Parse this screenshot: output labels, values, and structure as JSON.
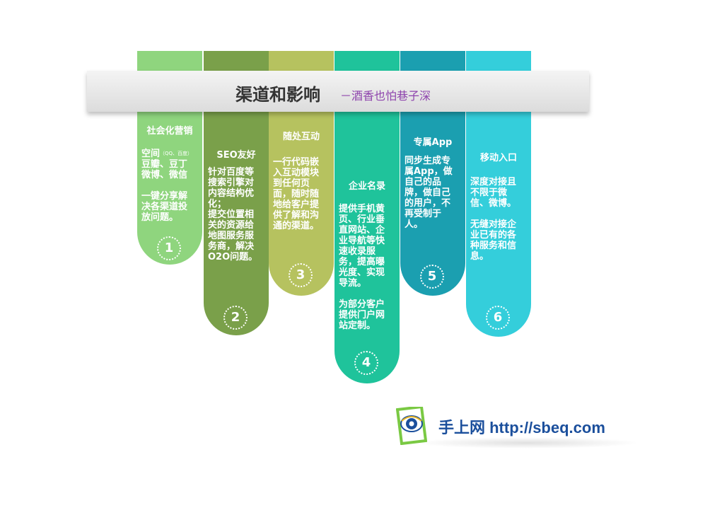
{
  "banner": {
    "title": "渠道和影响",
    "subtitle": "－酒香也怕巷子深"
  },
  "columns": [
    {
      "title": "社会化营销",
      "body_pre": "空间",
      "body_small": "（QQ、百度）",
      "body": "豆瓣、豆丁\n微博、微信\n\n一键分享解\n决各渠道投\n放问题。",
      "number": "1",
      "color": "#8fd57e"
    },
    {
      "title": "SEO友好",
      "body": "针对百度等\n搜索引擎对\n内容结构优\n化；\n提交位置相\n关的资源给\n地图服务服\n务商，解决\nO2O问题。",
      "number": "2",
      "color": "#7aa04a"
    },
    {
      "title": "随处互动",
      "body": "一行代码嵌\n入互动模块\n到任何页\n面，随时随\n地给客户提\n供了解和沟\n通的渠道。",
      "number": "3",
      "color": "#b6c25f"
    },
    {
      "title": "企业名录",
      "body": "提供手机黄\n页、行业垂\n直网站、企\n业导航等快\n速收录服\n务，提高曝\n光度、实现\n导流。\n\n为部分客户\n提供门户网\n站定制。",
      "number": "4",
      "color": "#1fc39b"
    },
    {
      "title": "专属App",
      "body": "同步生成专\n属App，做\n自己的品\n牌，做自己\n的用户，不\n再受制于\n人。",
      "number": "5",
      "color": "#1b9fb0"
    },
    {
      "title": "移动入口",
      "body": "深度对接且\n不限于微\n信、微博。\n\n无缝对接企\n业已有的各\n种服务和信\n息。",
      "number": "6",
      "color": "#34cedb"
    }
  ],
  "footer": {
    "brand": "手上网 http://sbeq.com"
  }
}
